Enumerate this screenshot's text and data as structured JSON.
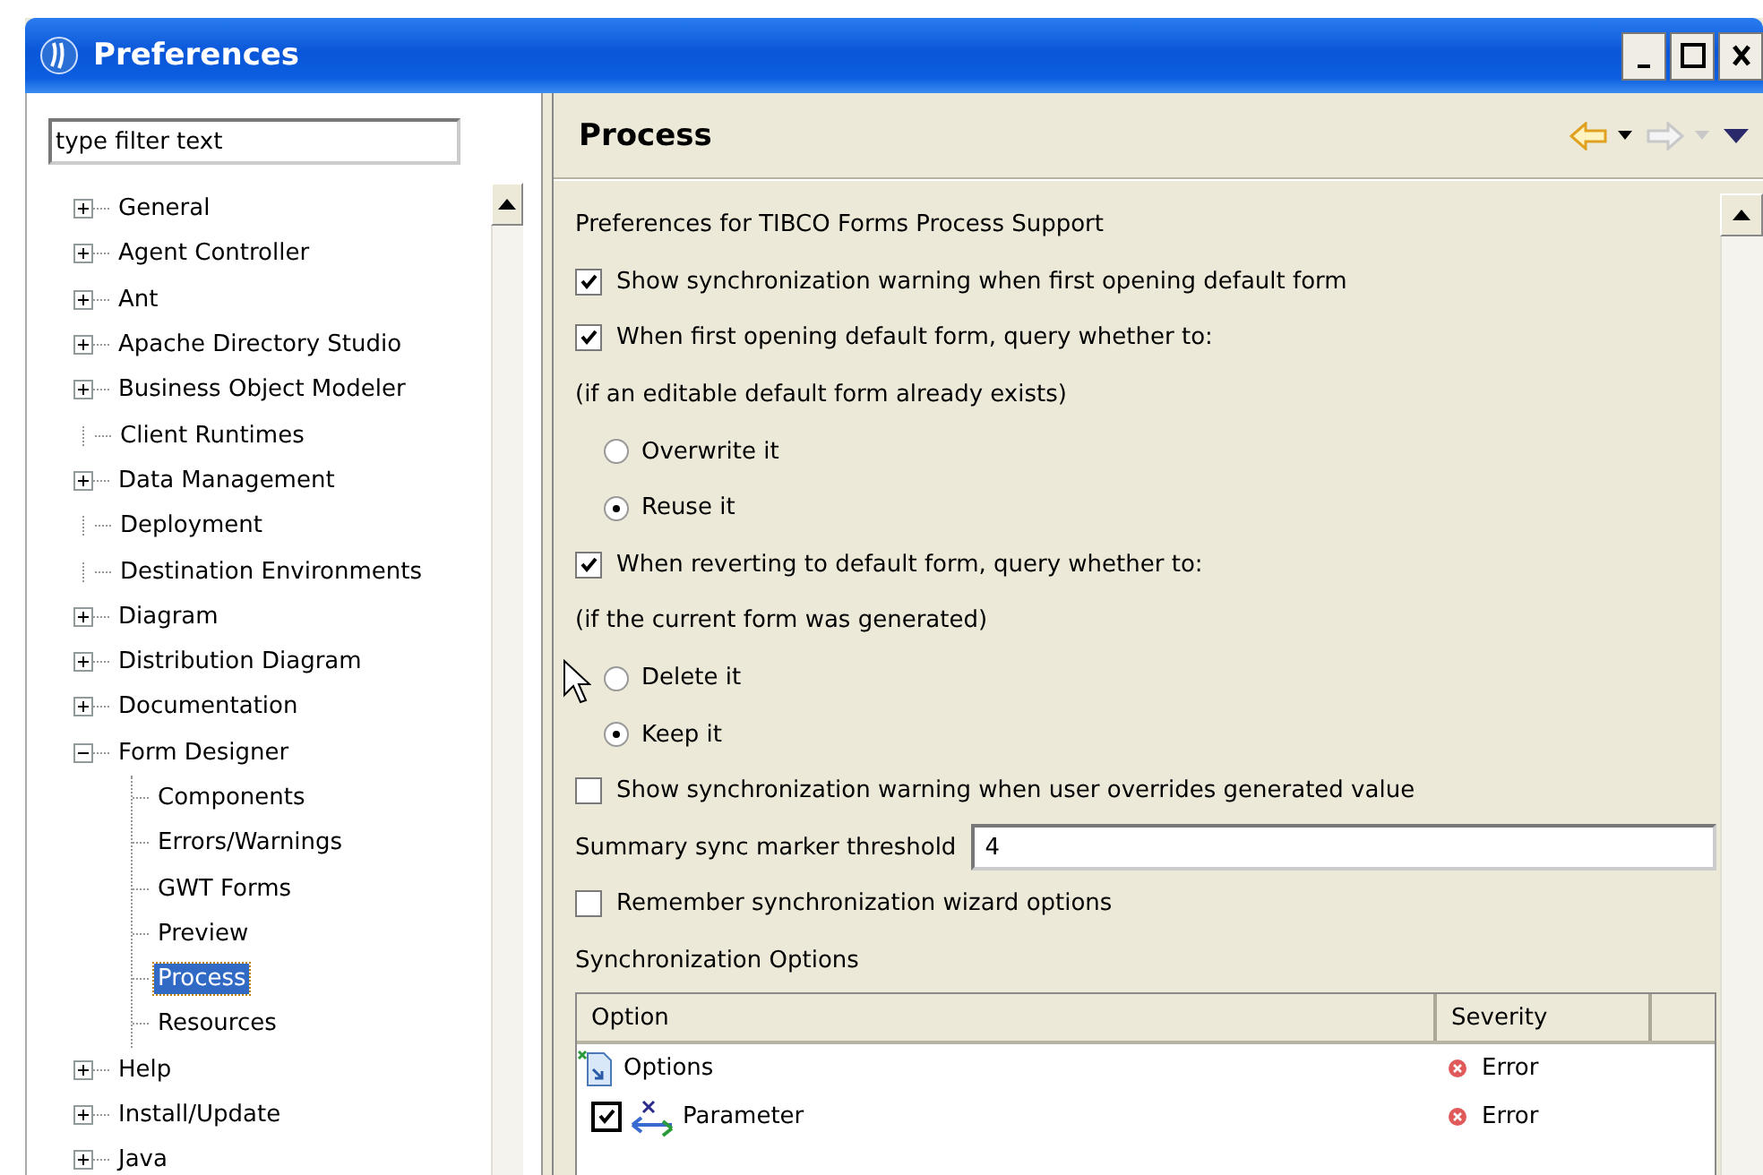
{
  "window": {
    "title": "Preferences"
  },
  "filter": {
    "placeholder": "type filter text"
  },
  "tree": [
    {
      "label": "General",
      "expandable": true,
      "expanded": false,
      "selected": false
    },
    {
      "label": "Agent Controller",
      "expandable": true,
      "expanded": false,
      "selected": false
    },
    {
      "label": "Ant",
      "expandable": true,
      "expanded": false,
      "selected": false
    },
    {
      "label": "Apache Directory Studio",
      "expandable": true,
      "expanded": false,
      "selected": false
    },
    {
      "label": "Business Object Modeler",
      "expandable": true,
      "expanded": false,
      "selected": false
    },
    {
      "label": "Client Runtimes",
      "expandable": false,
      "selected": false
    },
    {
      "label": "Data Management",
      "expandable": true,
      "expanded": false,
      "selected": false
    },
    {
      "label": "Deployment",
      "expandable": false,
      "selected": false
    },
    {
      "label": "Destination Environments",
      "expandable": false,
      "selected": false
    },
    {
      "label": "Diagram",
      "expandable": true,
      "expanded": false,
      "selected": false
    },
    {
      "label": "Distribution Diagram",
      "expandable": true,
      "expanded": false,
      "selected": false
    },
    {
      "label": "Documentation",
      "expandable": true,
      "expanded": false,
      "selected": false
    },
    {
      "label": "Form Designer",
      "expandable": true,
      "expanded": true,
      "selected": false,
      "children": [
        {
          "label": "Components",
          "expandable": false,
          "selected": false
        },
        {
          "label": "Errors/Warnings",
          "expandable": false,
          "selected": false
        },
        {
          "label": "GWT Forms",
          "expandable": false,
          "selected": false
        },
        {
          "label": "Preview",
          "expandable": false,
          "selected": false
        },
        {
          "label": "Process",
          "expandable": false,
          "selected": true
        },
        {
          "label": "Resources",
          "expandable": false,
          "selected": false
        }
      ]
    },
    {
      "label": "Help",
      "expandable": true,
      "expanded": false,
      "selected": false
    },
    {
      "label": "Install/Update",
      "expandable": true,
      "expanded": false,
      "selected": false
    },
    {
      "label": "Java",
      "expandable": true,
      "expanded": false,
      "selected": false
    }
  ],
  "page": {
    "title": "Process",
    "nav": [
      {
        "kind": "back",
        "disabled": false
      },
      {
        "kind": "forward",
        "disabled": true
      },
      {
        "kind": "menu",
        "disabled": false
      }
    ]
  },
  "settings": [
    {
      "kind": "label",
      "text": "Preferences for TIBCO Forms Process Support"
    },
    {
      "kind": "checkbox",
      "label": "Show synchronization warning when first opening default form",
      "checked": true
    },
    {
      "kind": "checkbox",
      "label": "When first opening default form, query whether to:",
      "checked": true
    },
    {
      "kind": "label",
      "text": "(if an editable default form already exists)"
    },
    {
      "kind": "radio",
      "label": "Overwrite it",
      "selected": false
    },
    {
      "kind": "radio",
      "label": "Reuse it",
      "selected": true
    },
    {
      "kind": "checkbox",
      "label": "When reverting to default form, query whether to:",
      "checked": true
    },
    {
      "kind": "label",
      "text": "(if the current form was generated)"
    },
    {
      "kind": "radio",
      "label": "Delete it",
      "selected": false
    },
    {
      "kind": "radio",
      "label": "Keep it",
      "selected": true
    },
    {
      "kind": "checkbox",
      "label": "Show synchronization warning when user overrides generated value",
      "checked": false
    },
    {
      "kind": "field",
      "label": "Summary sync marker threshold",
      "value": "4"
    },
    {
      "kind": "checkbox",
      "label": "Remember synchronization wizard options",
      "checked": false
    },
    {
      "kind": "label",
      "text": "Synchronization Options"
    }
  ],
  "table": {
    "columns": [
      "Option",
      "Severity"
    ],
    "rows": [
      {
        "kind": "group",
        "option": "Options",
        "severity": "Error"
      },
      {
        "kind": "checkbox",
        "option": "Parameter",
        "checked": true,
        "severity": "Error"
      }
    ]
  }
}
